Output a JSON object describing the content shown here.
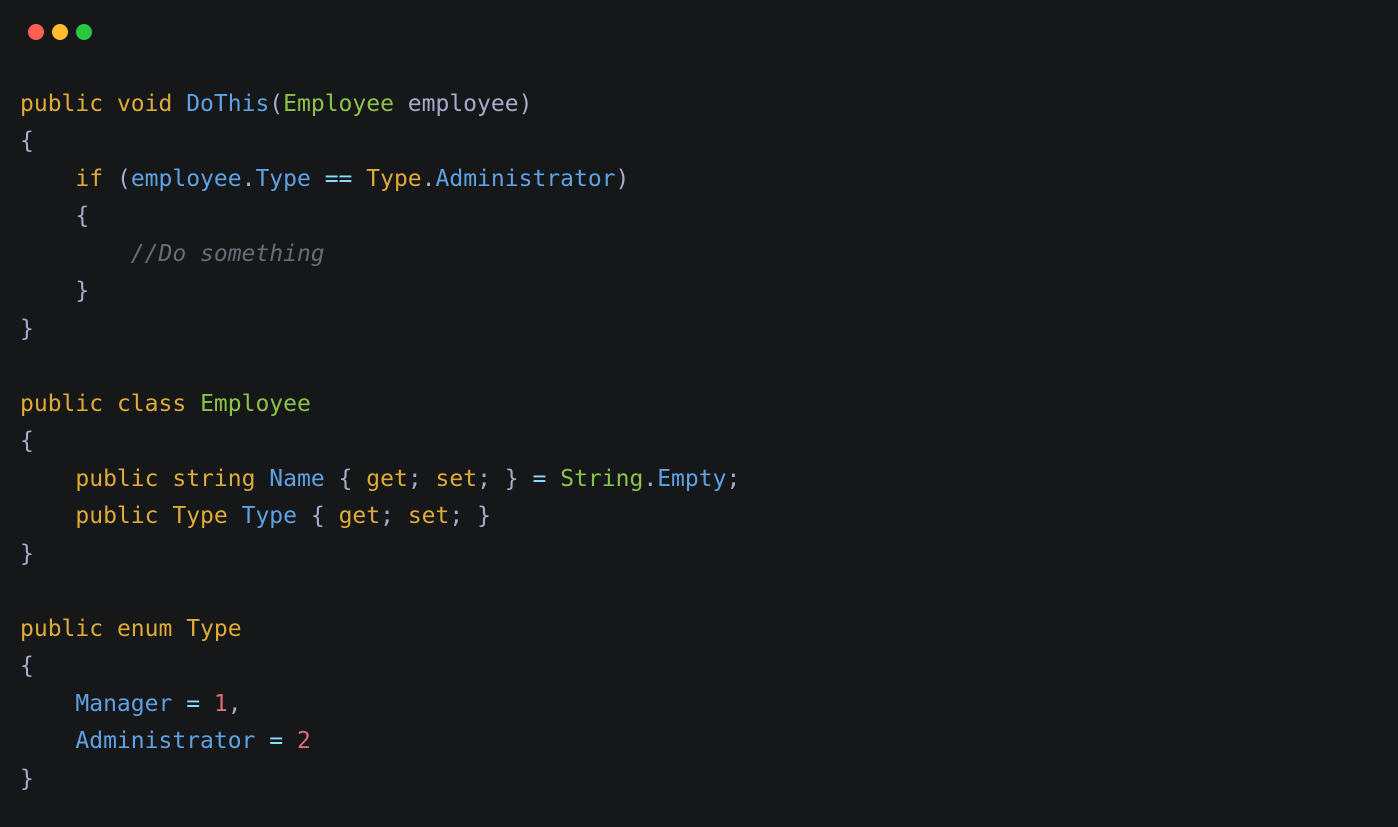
{
  "titlebar": {
    "buttons": [
      "close",
      "minimize",
      "maximize"
    ]
  },
  "code": {
    "tokens": {
      "public": "public",
      "void": "void",
      "class": "class",
      "enum": "enum",
      "string": "string",
      "if": "if",
      "get": "get",
      "set": "set",
      "DoThis": "DoThis",
      "Employee": "Employee",
      "employee": "employee",
      "Type": "Type",
      "Type2": "Type",
      "Administrator": "Administrator",
      "Name": "Name",
      "String": "String",
      "Empty": "Empty",
      "Manager": "Manager",
      "comment": "//Do something",
      "eq": "==",
      "assign": "=",
      "one": "1",
      "two": "2",
      "lbrace": "{",
      "rbrace": "}",
      "lparen": "(",
      "rparen": ")",
      "semi": ";",
      "comma": ",",
      "dot": "."
    }
  }
}
